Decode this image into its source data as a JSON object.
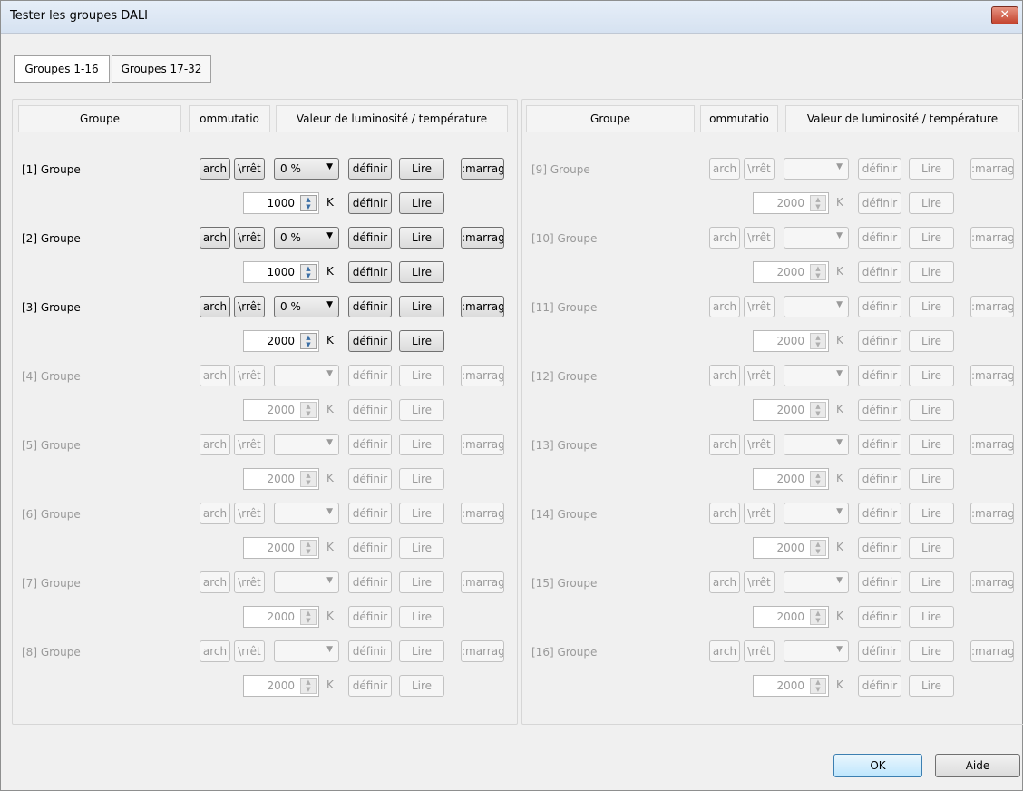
{
  "window": {
    "title": "Tester les groupes DALI",
    "close_label": "✕"
  },
  "tabs": [
    {
      "label": "Groupes 1-16"
    },
    {
      "label": "Groupes 17-32"
    }
  ],
  "headers": {
    "group": "Groupe",
    "switch": "ommutatio",
    "value": "Valeur de luminosité / température"
  },
  "buttons": {
    "on": "arch",
    "off": "\\rrêt",
    "set": "définir",
    "read": "Lire",
    "start": ":marrag"
  },
  "temp_unit": "K",
  "groups": [
    {
      "name": "[1] Groupe",
      "level": "0 %",
      "temperature": "1000",
      "enabled": true
    },
    {
      "name": "[2] Groupe",
      "level": "0 %",
      "temperature": "1000",
      "enabled": true
    },
    {
      "name": "[3] Groupe",
      "level": "0 %",
      "temperature": "2000",
      "enabled": true
    },
    {
      "name": "[4] Groupe",
      "level": "",
      "temperature": "2000",
      "enabled": false
    },
    {
      "name": "[5] Groupe",
      "level": "",
      "temperature": "2000",
      "enabled": false
    },
    {
      "name": "[6] Groupe",
      "level": "",
      "temperature": "2000",
      "enabled": false
    },
    {
      "name": "[7] Groupe",
      "level": "",
      "temperature": "2000",
      "enabled": false
    },
    {
      "name": "[8] Groupe",
      "level": "",
      "temperature": "2000",
      "enabled": false
    },
    {
      "name": "[9] Groupe",
      "level": "",
      "temperature": "2000",
      "enabled": false
    },
    {
      "name": "[10] Groupe",
      "level": "",
      "temperature": "2000",
      "enabled": false
    },
    {
      "name": "[11] Groupe",
      "level": "",
      "temperature": "2000",
      "enabled": false
    },
    {
      "name": "[12] Groupe",
      "level": "",
      "temperature": "2000",
      "enabled": false
    },
    {
      "name": "[13] Groupe",
      "level": "",
      "temperature": "2000",
      "enabled": false
    },
    {
      "name": "[14] Groupe",
      "level": "",
      "temperature": "2000",
      "enabled": false
    },
    {
      "name": "[15] Groupe",
      "level": "",
      "temperature": "2000",
      "enabled": false
    },
    {
      "name": "[16] Groupe",
      "level": "",
      "temperature": "2000",
      "enabled": false
    }
  ],
  "footer": {
    "ok_label": "OK",
    "help_label": "Aide"
  }
}
